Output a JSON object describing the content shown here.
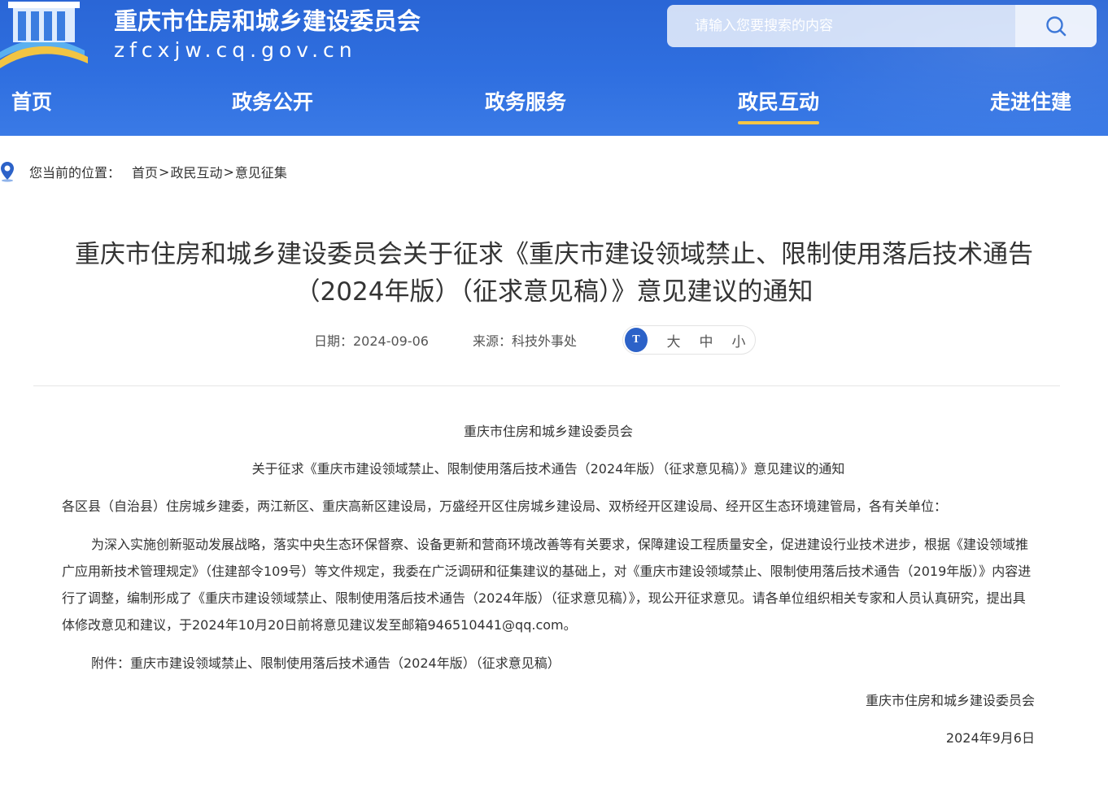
{
  "header": {
    "site_title": "重庆市住房和城乡建设委员会",
    "site_domain": "zfcxjw.cq.gov.cn",
    "search_placeholder": "请输入您要搜索的内容",
    "brand_color": "#2f6fe0",
    "active_underline_color": "#f5c545",
    "logo_icon": "building-logo-icon",
    "search_icon": "search-icon"
  },
  "nav": {
    "items": [
      {
        "label": "首页",
        "active": false
      },
      {
        "label": "政务公开",
        "active": false
      },
      {
        "label": "政务服务",
        "active": false
      },
      {
        "label": "政民互动",
        "active": true
      },
      {
        "label": "走进住建",
        "active": false
      }
    ]
  },
  "breadcrumb": {
    "icon": "location-pin-icon",
    "label": "您当前的位置：",
    "items": [
      "首页",
      "政民互动",
      "意见征集"
    ],
    "separator": ">"
  },
  "article": {
    "title_line1": "重庆市住房和城乡建设委员会关于征求《重庆市建设领域禁止、限制使用落后技术通告",
    "title_line2": "（2024年版）（征求意见稿）》意见建议的通知",
    "date": "日期：2024-09-06",
    "source": "来源：科技外事处",
    "font_size": {
      "icon": "font-size-icon",
      "icon_text": "T",
      "options": [
        "大",
        "中",
        "小"
      ]
    },
    "body": {
      "issuer": "重庆市住房和城乡建设委员会",
      "subject": "关于征求《重庆市建设领域禁止、限制使用落后技术通告（2024年版）（征求意见稿）》意见建议的通知",
      "recipients": "各区县（自治县）住房城乡建委，两江新区、重庆高新区建设局，万盛经开区住房城乡建设局、双桥经开区建设局、经开区生态环境建管局，各有关单位：",
      "main_text": "为深入实施创新驱动发展战略，落实中央生态环保督察、设备更新和营商环境改善等有关要求，保障建设工程质量安全，促进建设行业技术进步，根据《建设领域推广应用新技术管理规定》（住建部令109号）等文件规定，我委在广泛调研和征集建议的基础上，对《重庆市建设领域禁止、限制使用落后技术通告（2019年版）》内容进行了调整，编制形成了《重庆市建设领域禁止、限制使用落后技术通告（2024年版）（征求意见稿）》，现公开征求意见。请各单位组织相关专家和人员认真研究，提出具体修改意见和建议，于2024年10月20日前将意见建议发至邮箱946510441@qq.com。",
      "attachment": "附件：重庆市建设领域禁止、限制使用落后技术通告（2024年版）（征求意见稿）",
      "signature": "重庆市住房和城乡建设委员会",
      "sign_date": "2024年9月6日"
    }
  }
}
